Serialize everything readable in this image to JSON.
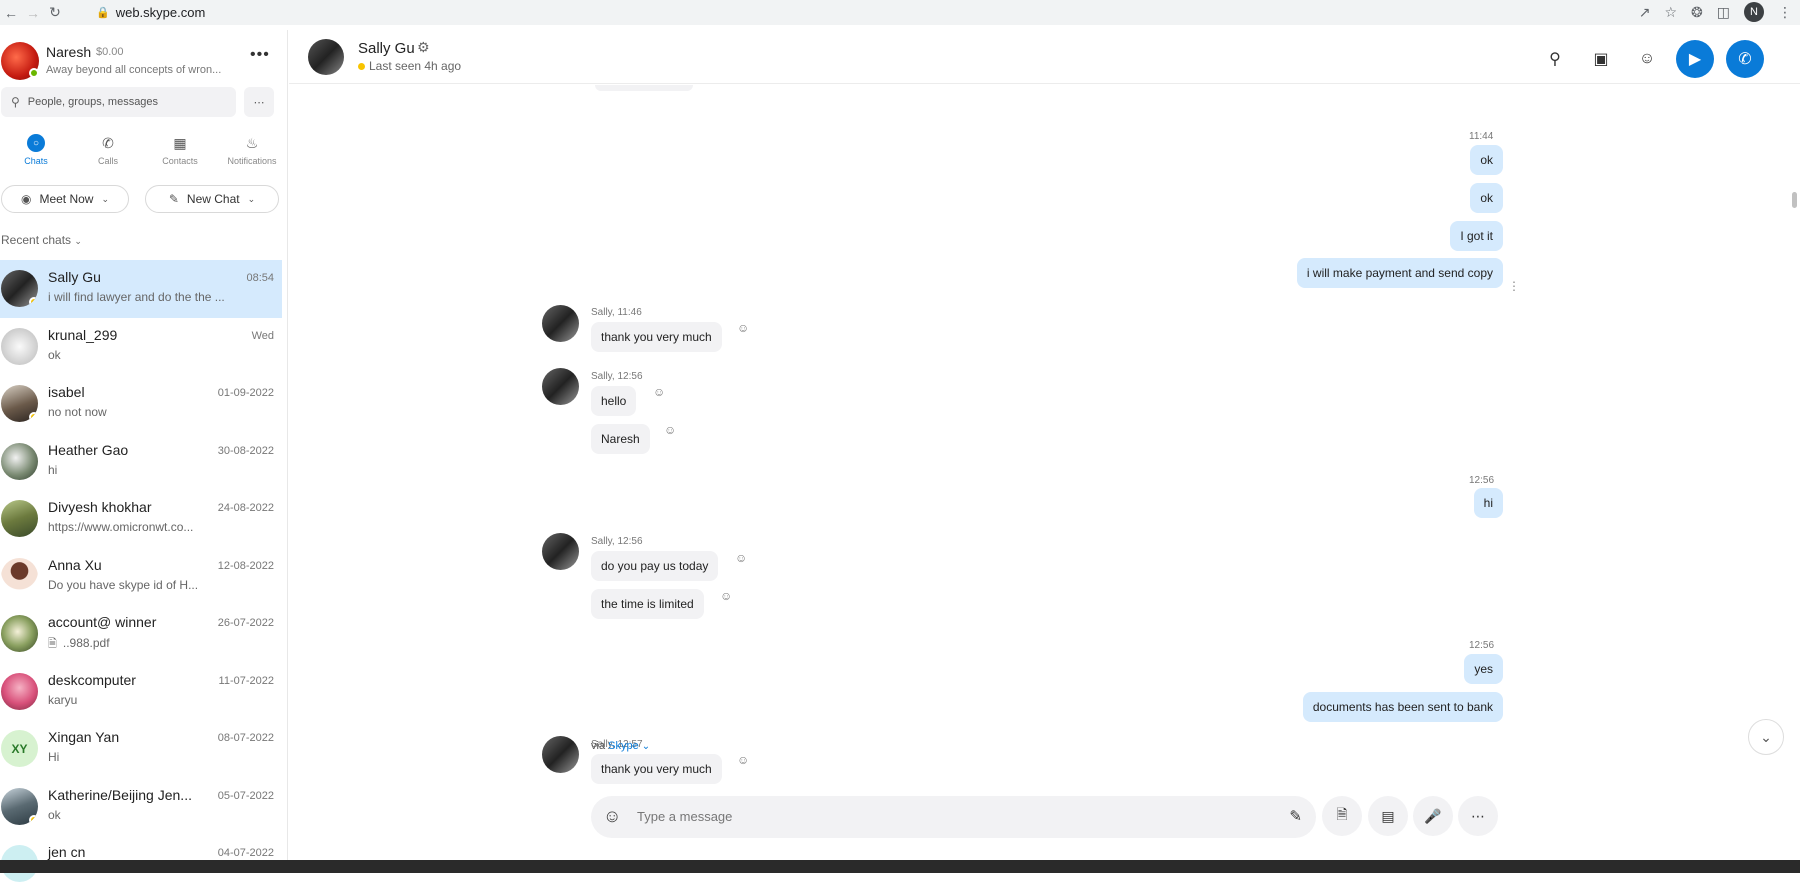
{
  "browser": {
    "url": "web.skype.com",
    "profile_initial": "N"
  },
  "me": {
    "name": "Naresh",
    "credit": "$0.00",
    "status": "Away beyond all concepts of wron..."
  },
  "search": {
    "placeholder": "People, groups, messages"
  },
  "tabs": [
    {
      "label": "Chats",
      "icon": "chat-icon",
      "active": true
    },
    {
      "label": "Calls",
      "icon": "phone-icon"
    },
    {
      "label": "Contacts",
      "icon": "contacts-icon"
    },
    {
      "label": "Notifications",
      "icon": "bell-icon"
    }
  ],
  "actions": {
    "meet_now": "Meet Now",
    "new_chat": "New Chat"
  },
  "recent_header": "Recent chats",
  "chats": [
    {
      "name": "Sally Gu",
      "preview": "i will find lawyer and do the the ...",
      "date": "08:54",
      "active": true
    },
    {
      "name": "krunal_299",
      "preview": "ok",
      "date": "Wed"
    },
    {
      "name": "isabel",
      "preview": "no not now",
      "date": "01-09-2022"
    },
    {
      "name": "Heather Gao",
      "preview": "hi",
      "date": "30-08-2022"
    },
    {
      "name": "Divyesh khokhar",
      "preview": "https://www.omicronwt.co...",
      "date": "24-08-2022"
    },
    {
      "name": "Anna Xu",
      "preview": "Do you have skype id of H...",
      "date": "12-08-2022"
    },
    {
      "name": "account@ winner",
      "preview": "..988.pdf",
      "date": "26-07-2022"
    },
    {
      "name": "deskcomputer",
      "preview": "karyu",
      "date": "11-07-2022"
    },
    {
      "name": "Xingan  Yan",
      "preview": "Hi",
      "date": "08-07-2022",
      "initials": "XY"
    },
    {
      "name": "Katherine/Beijing Jen...",
      "preview": "ok",
      "date": "05-07-2022"
    },
    {
      "name": "jen cn",
      "preview": "",
      "date": "04-07-2022"
    }
  ],
  "conversation": {
    "name": "Sally Gu",
    "last_seen": "Last seen 4h ago",
    "messages": {
      "t1": "11:44",
      "m1": "ok",
      "m2": "ok",
      "m3": "I got it",
      "m4": "i will make payment and send copy",
      "s1": "Sally, 11:46",
      "m5": "thank you very much",
      "s2": "Sally, 12:56",
      "m6": "hello",
      "m7": "Naresh",
      "t2": "12:56",
      "m8": "hi",
      "s3": "Sally, 12:56",
      "m9": "do you pay us today",
      "m10": "the time is limited",
      "t3": "12:56",
      "m11": "yes",
      "m12": "documents has been sent to bank",
      "s4": "Sally, 12:57",
      "m13": "thank you very much"
    },
    "via_prefix": "via",
    "via_link": "Skype",
    "composer_placeholder": "Type a message"
  },
  "colors": {
    "accent": "#0a7bd8",
    "outgoing_bubble": "#d5eafd",
    "incoming_bubble": "#f2f2f4"
  }
}
